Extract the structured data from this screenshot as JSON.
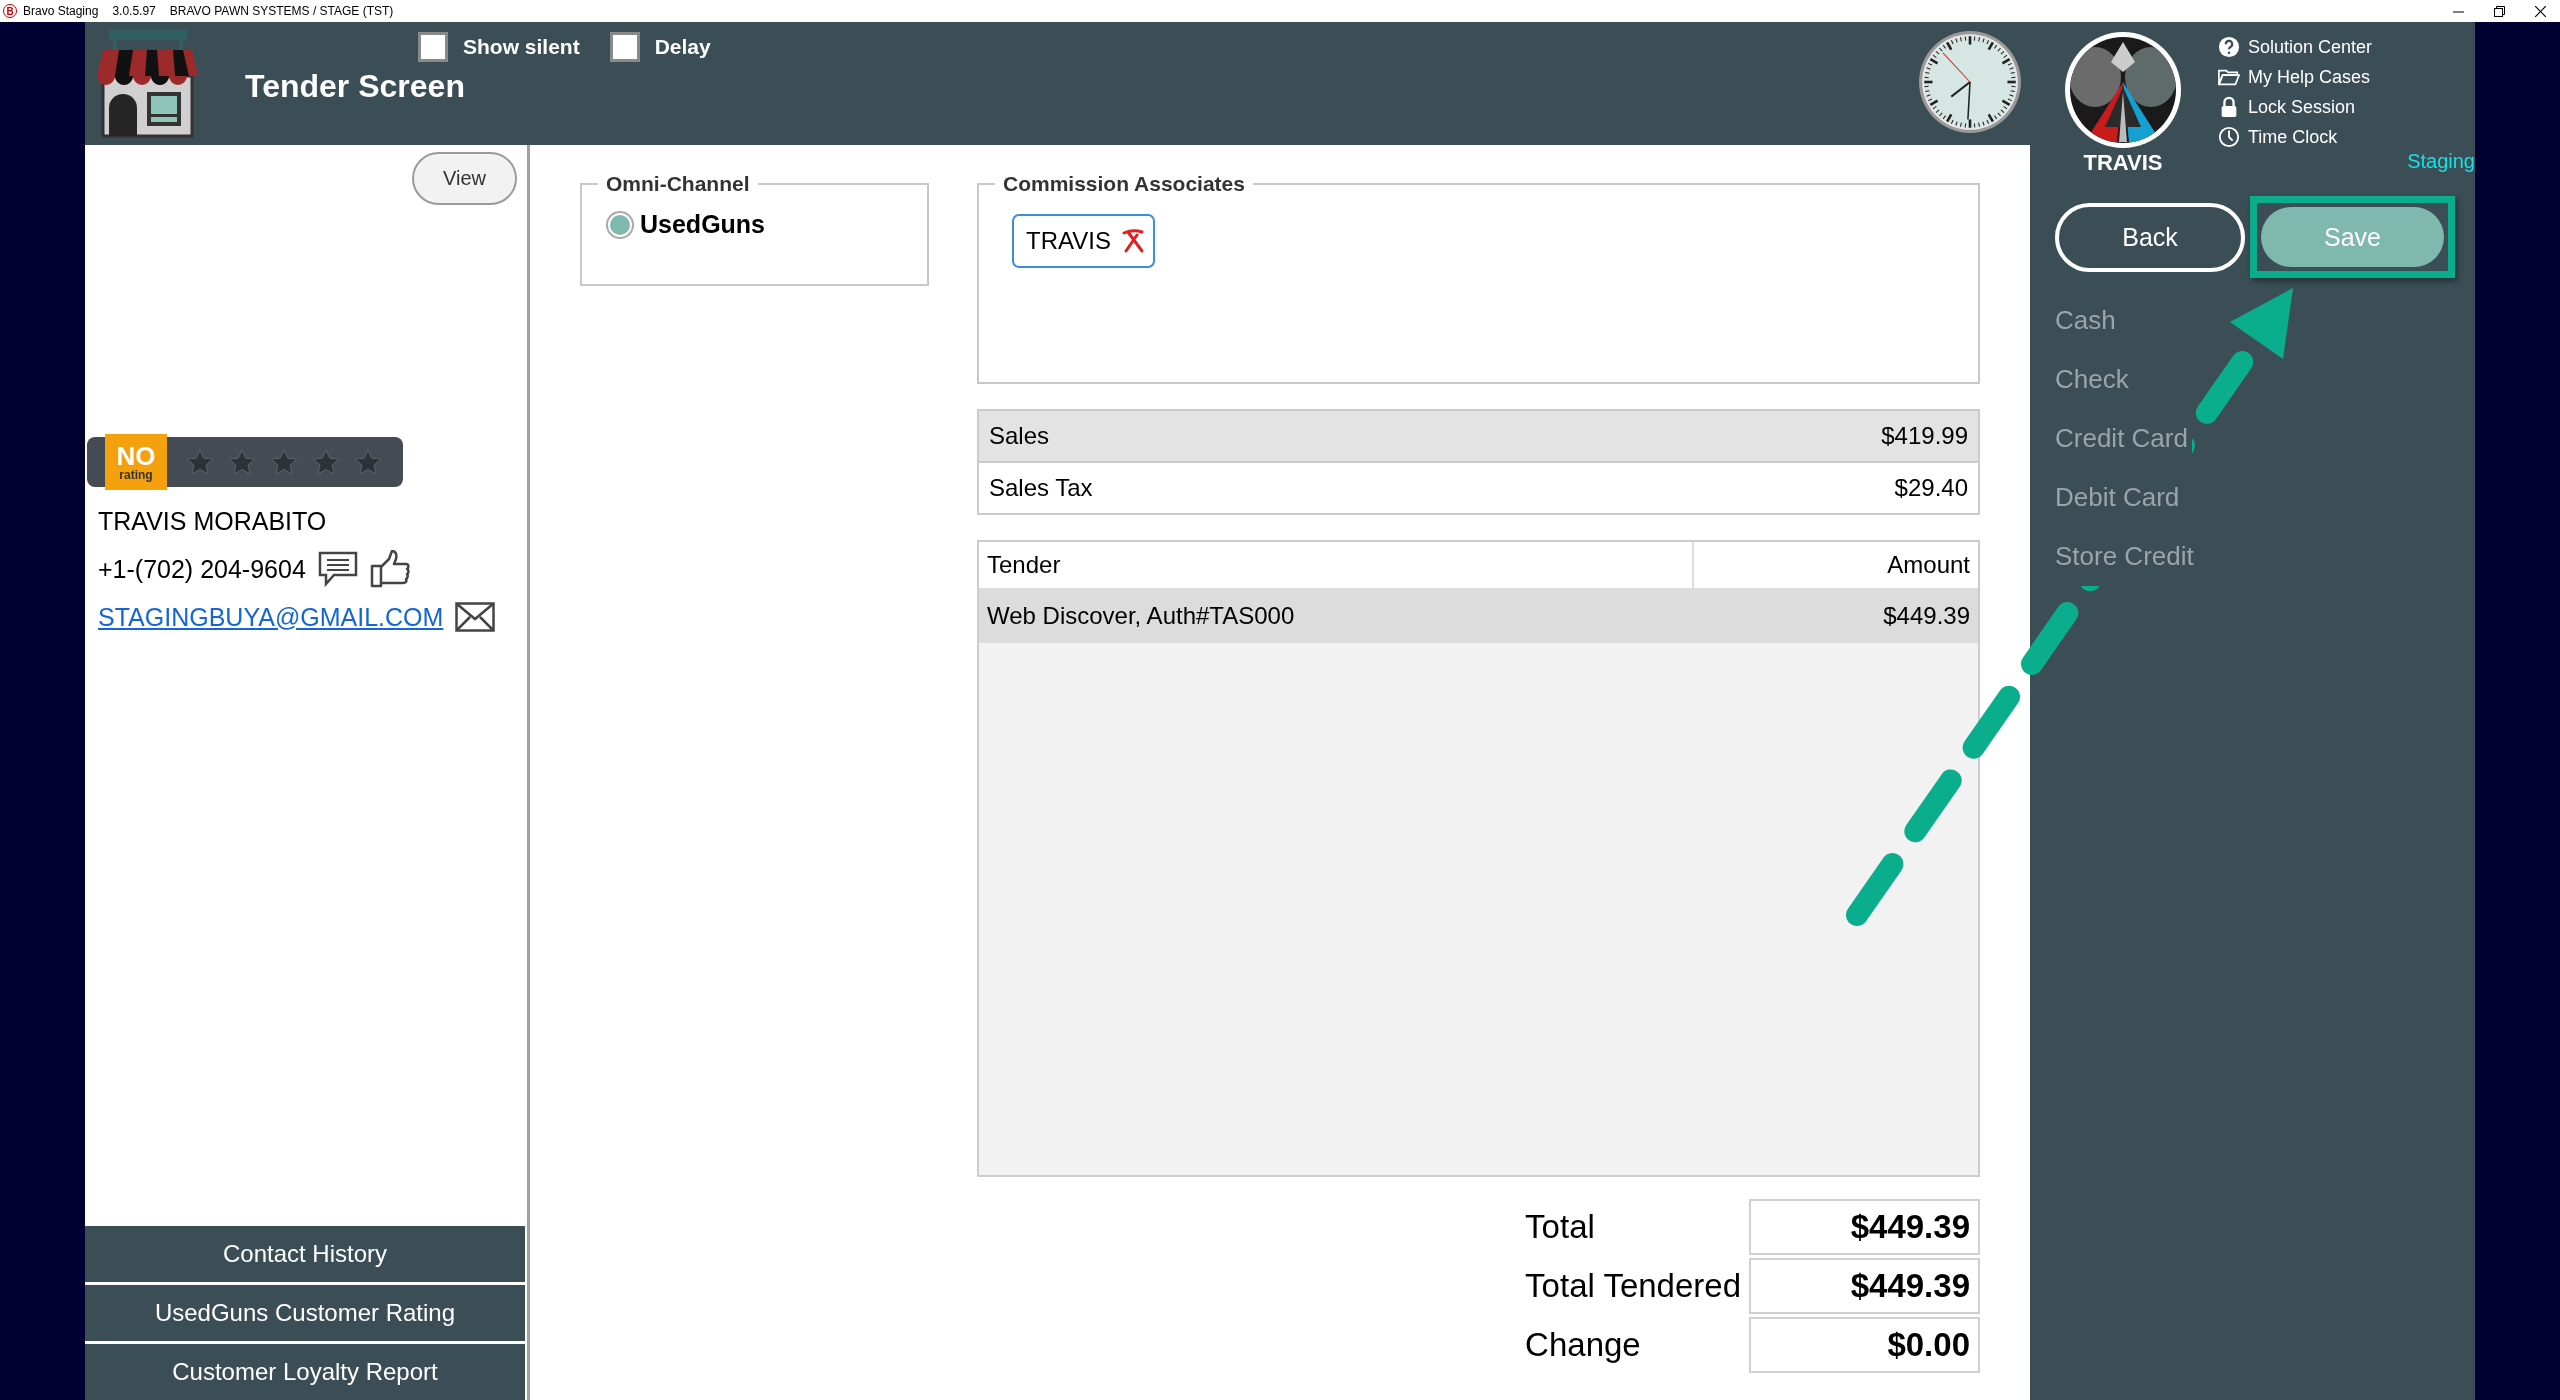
{
  "title_bar": {
    "logo": "B",
    "app": "Bravo Staging",
    "version": "3.0.5.97",
    "system": "BRAVO PAWN SYSTEMS / STAGE (TST)"
  },
  "header": {
    "title": "Tender Screen",
    "options": [
      {
        "label": "Show silent",
        "checked": false
      },
      {
        "label": "Delay",
        "checked": false
      }
    ]
  },
  "user_panel": {
    "name": "TRAVIS",
    "help_links": [
      "Solution Center",
      "My Help Cases",
      "Lock Session",
      "Time Clock"
    ],
    "environment": "Staging"
  },
  "customer": {
    "view_button": "View",
    "rating": {
      "badge_top": "NO",
      "badge_bottom": "rating",
      "stars": 0
    },
    "name": "TRAVIS MORABITO",
    "phone": "+1-(702) 204-9604",
    "email": "STAGINGBUYA@GMAIL.COM",
    "actions": [
      "Contact History",
      "UsedGuns Customer Rating",
      "Customer Loyalty Report"
    ]
  },
  "omni_channel": {
    "legend": "Omni-Channel",
    "options": [
      {
        "label": "UsedGuns",
        "selected": true
      }
    ]
  },
  "commission": {
    "legend": "Commission Associates",
    "associates": [
      "TRAVIS"
    ]
  },
  "summary": [
    {
      "label": "Sales",
      "value": "$419.99"
    },
    {
      "label": "Sales Tax",
      "value": "$29.40"
    }
  ],
  "tender_table": {
    "columns": [
      "Tender",
      "Amount"
    ],
    "rows": [
      {
        "tender": "Web Discover, Auth#TAS000",
        "amount": "$449.39",
        "selected": true
      }
    ]
  },
  "totals": [
    {
      "label": "Total",
      "value": "$449.39"
    },
    {
      "label": "Total Tendered",
      "value": "$449.39"
    },
    {
      "label": "Change",
      "value": "$0.00"
    }
  ],
  "buttons": {
    "back": "Back",
    "save": "Save"
  },
  "tender_options": [
    {
      "label": "Cash",
      "disabled": true
    },
    {
      "label": "Check",
      "disabled": true
    },
    {
      "label": "Credit Card",
      "disabled": true
    },
    {
      "label": "Debit Card",
      "disabled": true
    },
    {
      "label": "Store Credit",
      "disabled": true
    }
  ]
}
